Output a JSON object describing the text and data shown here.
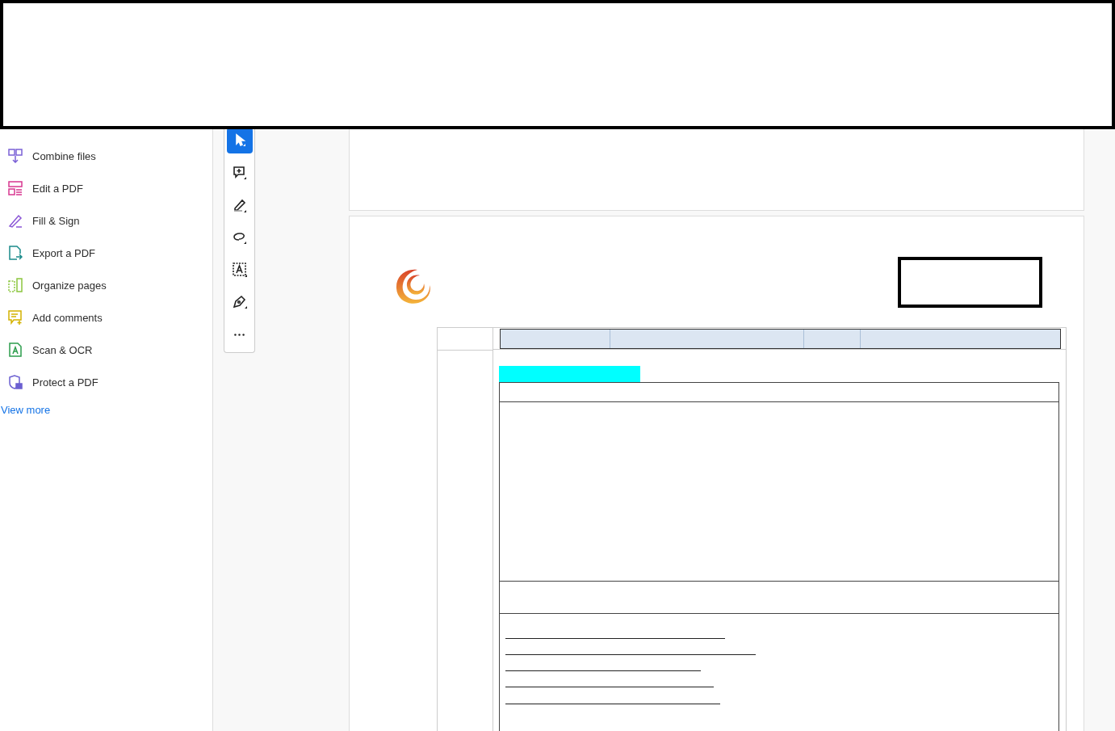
{
  "tools": [
    {
      "kind": "combine",
      "label": "Combine files"
    },
    {
      "kind": "edit",
      "label": "Edit a PDF"
    },
    {
      "kind": "sign",
      "label": "Fill & Sign"
    },
    {
      "kind": "export",
      "label": "Export a PDF"
    },
    {
      "kind": "organize",
      "label": "Organize pages"
    },
    {
      "kind": "comment",
      "label": "Add comments"
    },
    {
      "kind": "scan",
      "label": "Scan & OCR"
    },
    {
      "kind": "protect",
      "label": "Protect a PDF"
    }
  ],
  "view_more": "View more",
  "toolbar": [
    {
      "kind": "select",
      "selected": true
    },
    {
      "kind": "comment",
      "selected": false
    },
    {
      "kind": "highlight",
      "selected": false
    },
    {
      "kind": "lasso",
      "selected": false
    },
    {
      "kind": "textselect",
      "selected": false
    },
    {
      "kind": "sign",
      "selected": false
    },
    {
      "kind": "more",
      "selected": false
    }
  ]
}
